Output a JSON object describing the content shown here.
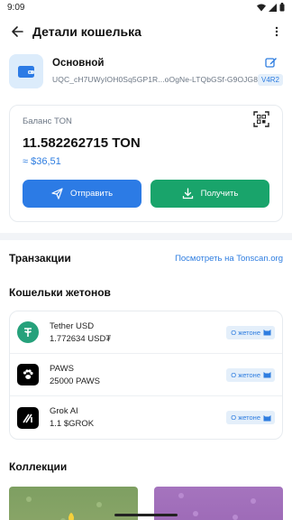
{
  "status": {
    "time": "9:09"
  },
  "app_bar": {
    "title": "Детали кошелька"
  },
  "wallet": {
    "name": "Основной",
    "address": "UQC_cH7UWyIOH0Sq5GP1R...oOgNe-LTQbGSf-G9OJG8xa",
    "version": "V4R2"
  },
  "balance": {
    "label": "Баланс TON",
    "value": "11.582262715 TON",
    "fiat": "≈ $36,51",
    "send_label": "Отправить",
    "receive_label": "Получить"
  },
  "transactions": {
    "title": "Транзакции",
    "link": "Посмотреть на Tonscan.org"
  },
  "jettons": {
    "title": "Кошельки жетонов",
    "about_label": "О жетоне",
    "items": [
      {
        "name": "Tether USD",
        "amount": "1.772634 USD₮",
        "logo_color": "#26a17b"
      },
      {
        "name": "PAWS",
        "amount": "25000 PAWS",
        "logo_color": "#000000"
      },
      {
        "name": "Grok AI",
        "amount": "1.1 $GROK",
        "logo_color": "#000000"
      }
    ]
  },
  "collections": {
    "title": "Коллекции"
  },
  "colors": {
    "accent": "#2c7be5",
    "green": "#19a46b"
  }
}
